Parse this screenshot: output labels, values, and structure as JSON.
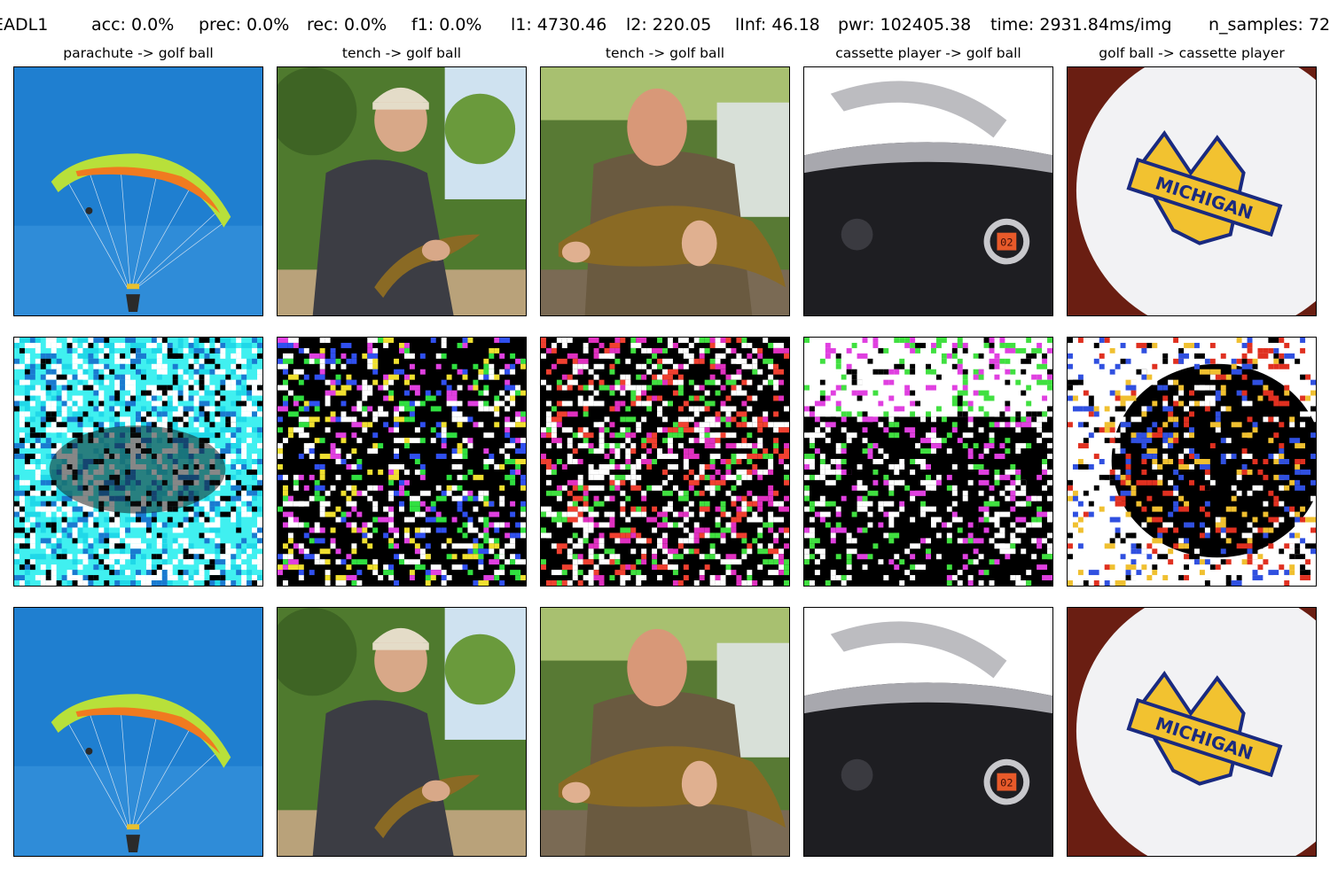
{
  "metrics": {
    "method": "EADL1",
    "acc": "acc: 0.0%",
    "prec": "prec: 0.0%",
    "rec": "rec: 0.0%",
    "f1": "f1: 0.0%",
    "l1": "l1: 4730.46",
    "l2": "l2: 220.05",
    "linf": "lInf: 46.18",
    "pwr": "pwr: 102405.38",
    "time": "time: 2931.84ms/img",
    "n_samples": "n_samples: 72"
  },
  "columns": [
    {
      "title": "parachute -> golf ball"
    },
    {
      "title": "tench -> golf ball"
    },
    {
      "title": "tench -> golf ball"
    },
    {
      "title": "cassette player -> golf ball"
    },
    {
      "title": "golf ball -> cassette player"
    }
  ],
  "rows": [
    "original",
    "perturbation",
    "adversarial"
  ],
  "image_text": {
    "golf_ball_logo": "MICHIGAN",
    "cassette_display": "02"
  },
  "colors": {
    "sky": "#1f7fd0",
    "canopy": "#b8e03a",
    "canopy_stripe": "#f07a20",
    "foliage": "#4f7a2e",
    "coat": "#3c3d44",
    "fish": "#8a6a24",
    "ball": "#f2f2f4",
    "michigan_maize": "#f2c230",
    "michigan_blue": "#1a2a80",
    "ball_background": "#6a1e12",
    "boombox_body": "#1e1e22",
    "boombox_display": "#e85a2a"
  }
}
